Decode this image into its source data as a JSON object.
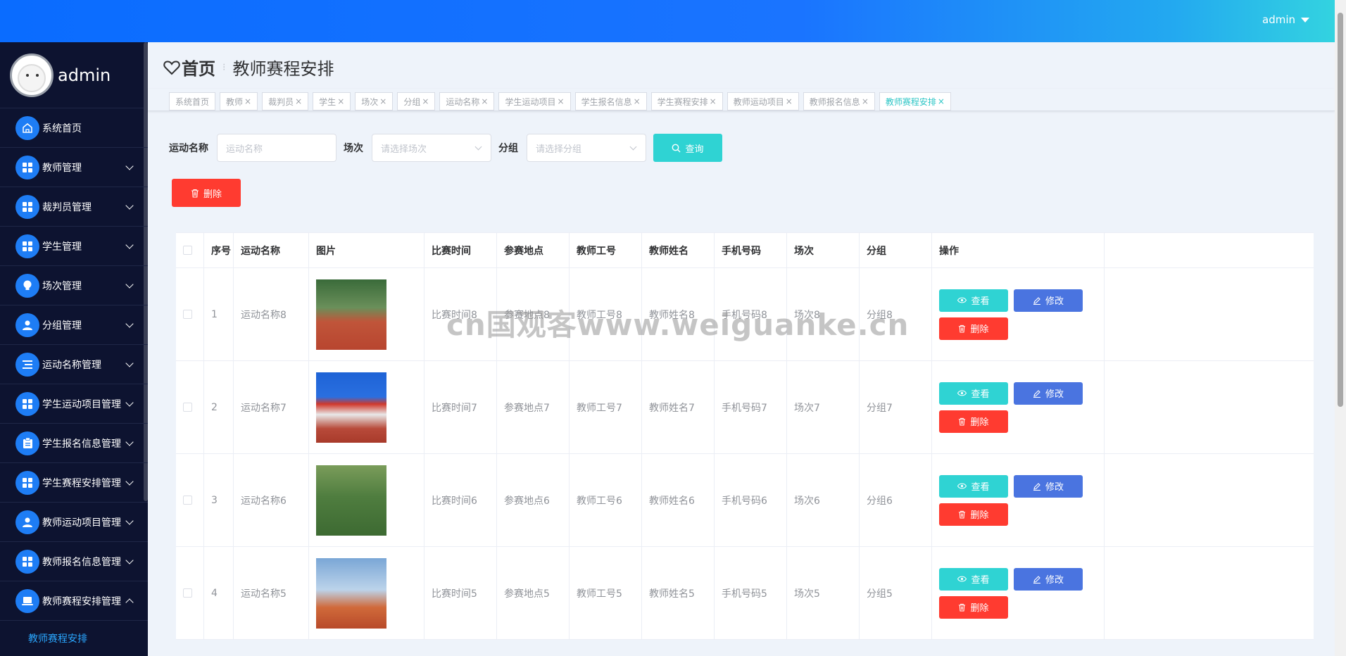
{
  "topbar": {
    "user": "admin"
  },
  "sidebar": {
    "profile_name": "admin",
    "items": [
      {
        "label": "系统首页",
        "icon": "home-icon"
      },
      {
        "label": "教师管理",
        "icon": "grid-icon"
      },
      {
        "label": "裁判员管理",
        "icon": "grid-icon"
      },
      {
        "label": "学生管理",
        "icon": "grid-icon"
      },
      {
        "label": "场次管理",
        "icon": "bulb-icon"
      },
      {
        "label": "分组管理",
        "icon": "user-icon"
      },
      {
        "label": "运动名称管理",
        "icon": "list-icon"
      },
      {
        "label": "学生运动项目管理",
        "icon": "grid-icon"
      },
      {
        "label": "学生报名信息管理",
        "icon": "clipboard-icon"
      },
      {
        "label": "学生赛程安排管理",
        "icon": "grid-icon"
      },
      {
        "label": "教师运动项目管理",
        "icon": "user-icon"
      },
      {
        "label": "教师报名信息管理",
        "icon": "grid-icon"
      },
      {
        "label": "教师赛程安排管理",
        "icon": "laptop-icon"
      }
    ],
    "sub_item": "教师赛程安排"
  },
  "breadcrumb": {
    "home": "首页",
    "current": "教师赛程安排"
  },
  "tags": [
    {
      "label": "系统首页",
      "closable": false,
      "active": false
    },
    {
      "label": "教师",
      "closable": true,
      "active": false
    },
    {
      "label": "裁判员",
      "closable": true,
      "active": false
    },
    {
      "label": "学生",
      "closable": true,
      "active": false
    },
    {
      "label": "场次",
      "closable": true,
      "active": false
    },
    {
      "label": "分组",
      "closable": true,
      "active": false
    },
    {
      "label": "运动名称",
      "closable": true,
      "active": false
    },
    {
      "label": "学生运动项目",
      "closable": true,
      "active": false
    },
    {
      "label": "学生报名信息",
      "closable": true,
      "active": false
    },
    {
      "label": "学生赛程安排",
      "closable": true,
      "active": false
    },
    {
      "label": "教师运动项目",
      "closable": true,
      "active": false
    },
    {
      "label": "教师报名信息",
      "closable": true,
      "active": false
    },
    {
      "label": "教师赛程安排",
      "closable": true,
      "active": true
    }
  ],
  "search": {
    "name_label": "运动名称",
    "name_placeholder": "运动名称",
    "round_label": "场次",
    "round_placeholder": "请选择场次",
    "group_label": "分组",
    "group_placeholder": "请选择分组",
    "query_button": "查询"
  },
  "delete_button": "删除",
  "table": {
    "headers": [
      "序号",
      "运动名称",
      "图片",
      "比赛时间",
      "参赛地点",
      "教师工号",
      "教师姓名",
      "手机号码",
      "场次",
      "分组",
      "操作"
    ],
    "rows": [
      {
        "index": "1",
        "name": "运动名称8",
        "time": "比赛时间8",
        "place": "参赛地点8",
        "teacher_no": "教师工号8",
        "teacher_name": "教师姓名8",
        "phone": "手机号码8",
        "round": "场次8",
        "group": "分组8"
      },
      {
        "index": "2",
        "name": "运动名称7",
        "time": "比赛时间7",
        "place": "参赛地点7",
        "teacher_no": "教师工号7",
        "teacher_name": "教师姓名7",
        "phone": "手机号码7",
        "round": "场次7",
        "group": "分组7"
      },
      {
        "index": "3",
        "name": "运动名称6",
        "time": "比赛时间6",
        "place": "参赛地点6",
        "teacher_no": "教师工号6",
        "teacher_name": "教师姓名6",
        "phone": "手机号码6",
        "round": "场次6",
        "group": "分组6"
      },
      {
        "index": "4",
        "name": "运动名称5",
        "time": "比赛时间5",
        "place": "参赛地点5",
        "teacher_no": "教师工号5",
        "teacher_name": "教师姓名5",
        "phone": "手机号码5",
        "round": "场次5",
        "group": "分组5"
      }
    ],
    "actions": {
      "view": "查看",
      "edit": "修改",
      "delete": "删除"
    }
  },
  "watermark": "cn国观客www.weiguanke.cn",
  "colors": {
    "accent": "#2fd3d3",
    "danger": "#ff3b30",
    "primary": "#4a74e0",
    "sidebar": "#0d1330"
  }
}
